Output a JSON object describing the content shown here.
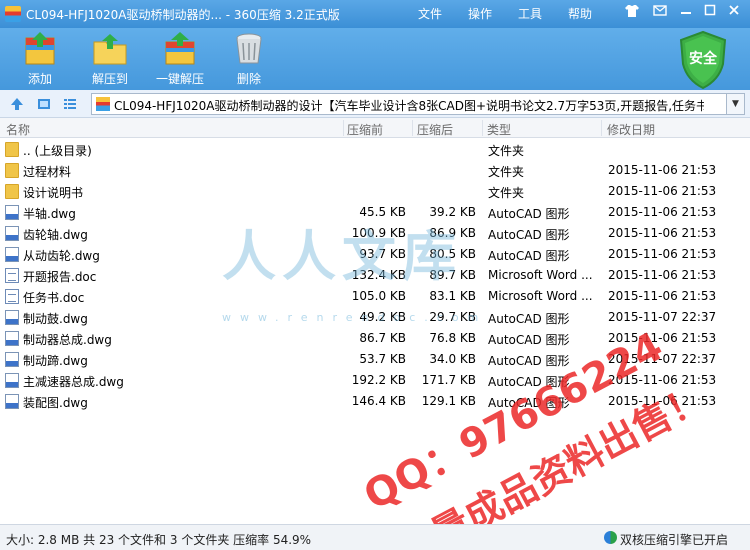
{
  "titlebar": {
    "title": "CL094-HFJ1020A驱动桥制动器的... - 360压缩 3.2正式版",
    "menu": [
      "文件",
      "操作",
      "工具",
      "帮助"
    ]
  },
  "toolbar": {
    "buttons": [
      {
        "label": "添加",
        "icon": "add-archive-icon"
      },
      {
        "label": "解压到",
        "icon": "extract-to-icon"
      },
      {
        "label": "一键解压",
        "icon": "one-click-extract-icon"
      },
      {
        "label": "删除",
        "icon": "delete-trash-icon"
      }
    ],
    "security_badge": "安全"
  },
  "addressbar": {
    "path": "CL094-HFJ1020A驱动桥制动器的设计【汽车毕业设计含8张CAD图+说明书论文2.7万字53页,开题报告,任务书】V"
  },
  "columns": [
    "名称",
    "压缩前",
    "压缩后",
    "类型",
    "修改日期"
  ],
  "files": [
    {
      "name": ".. (上级目录)",
      "before": "",
      "after": "",
      "type": "文件夹",
      "date": "",
      "icon": "folder"
    },
    {
      "name": "过程材料",
      "before": "",
      "after": "",
      "type": "文件夹",
      "date": "2015-11-06 21:53",
      "icon": "folder"
    },
    {
      "name": "设计说明书",
      "before": "",
      "after": "",
      "type": "文件夹",
      "date": "2015-11-06 21:53",
      "icon": "folder"
    },
    {
      "name": "半轴.dwg",
      "before": "45.5 KB",
      "after": "39.2 KB",
      "type": "AutoCAD 图形",
      "date": "2015-11-06 21:53",
      "icon": "dwg"
    },
    {
      "name": "齿轮轴.dwg",
      "before": "100.9 KB",
      "after": "86.9 KB",
      "type": "AutoCAD 图形",
      "date": "2015-11-06 21:53",
      "icon": "dwg"
    },
    {
      "name": "从动齿轮.dwg",
      "before": "93.7 KB",
      "after": "80.5 KB",
      "type": "AutoCAD 图形",
      "date": "2015-11-06 21:53",
      "icon": "dwg"
    },
    {
      "name": "开题报告.doc",
      "before": "132.4 KB",
      "after": "89.7 KB",
      "type": "Microsoft Word ...",
      "date": "2015-11-06 21:53",
      "icon": "doc"
    },
    {
      "name": "任务书.doc",
      "before": "105.0 KB",
      "after": "83.1 KB",
      "type": "Microsoft Word ...",
      "date": "2015-11-06 21:53",
      "icon": "doc"
    },
    {
      "name": "制动鼓.dwg",
      "before": "49.2 KB",
      "after": "29.7 KB",
      "type": "AutoCAD 图形",
      "date": "2015-11-07 22:37",
      "icon": "dwg"
    },
    {
      "name": "制动器总成.dwg",
      "before": "86.7 KB",
      "after": "76.8 KB",
      "type": "AutoCAD 图形",
      "date": "2015-11-06 21:53",
      "icon": "dwg"
    },
    {
      "name": "制动蹄.dwg",
      "before": "53.7 KB",
      "after": "34.0 KB",
      "type": "AutoCAD 图形",
      "date": "2015-11-07 22:37",
      "icon": "dwg"
    },
    {
      "name": "主减速器总成.dwg",
      "before": "192.2 KB",
      "after": "171.7 KB",
      "type": "AutoCAD 图形",
      "date": "2015-11-06 21:53",
      "icon": "dwg"
    },
    {
      "name": "装配图.dwg",
      "before": "146.4 KB",
      "after": "129.1 KB",
      "type": "AutoCAD 图形",
      "date": "2015-11-06 21:53",
      "icon": "dwg"
    }
  ],
  "watermark": {
    "logo": "人人文库",
    "url": "www.renrendoc.com",
    "line1": "QQ：97666224",
    "line2": "海量成品资料出售！"
  },
  "statusbar": {
    "summary": "大小: 2.8 MB 共 23 个文件和 3 个文件夹 压缩率 54.9%",
    "right": "双核压缩引擎已开启"
  }
}
